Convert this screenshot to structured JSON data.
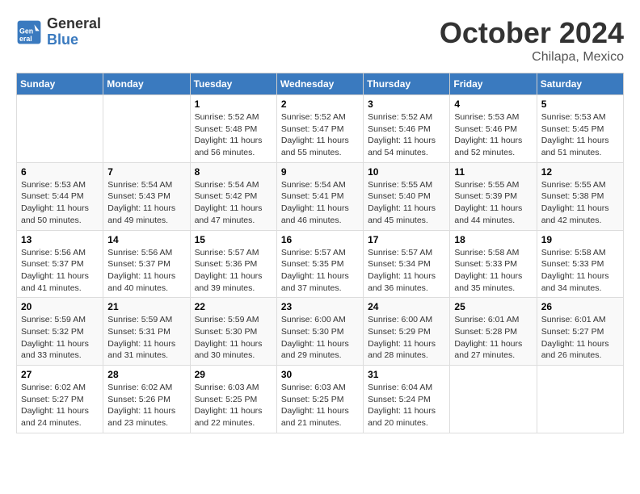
{
  "header": {
    "logo": {
      "line1": "General",
      "line2": "Blue"
    },
    "month": "October 2024",
    "location": "Chilapa, Mexico"
  },
  "weekdays": [
    "Sunday",
    "Monday",
    "Tuesday",
    "Wednesday",
    "Thursday",
    "Friday",
    "Saturday"
  ],
  "weeks": [
    [
      null,
      null,
      {
        "day": 1,
        "sunrise": "5:52 AM",
        "sunset": "5:48 PM",
        "daylight": "11 hours and 56 minutes."
      },
      {
        "day": 2,
        "sunrise": "5:52 AM",
        "sunset": "5:47 PM",
        "daylight": "11 hours and 55 minutes."
      },
      {
        "day": 3,
        "sunrise": "5:52 AM",
        "sunset": "5:46 PM",
        "daylight": "11 hours and 54 minutes."
      },
      {
        "day": 4,
        "sunrise": "5:53 AM",
        "sunset": "5:46 PM",
        "daylight": "11 hours and 52 minutes."
      },
      {
        "day": 5,
        "sunrise": "5:53 AM",
        "sunset": "5:45 PM",
        "daylight": "11 hours and 51 minutes."
      }
    ],
    [
      {
        "day": 6,
        "sunrise": "5:53 AM",
        "sunset": "5:44 PM",
        "daylight": "11 hours and 50 minutes."
      },
      {
        "day": 7,
        "sunrise": "5:54 AM",
        "sunset": "5:43 PM",
        "daylight": "11 hours and 49 minutes."
      },
      {
        "day": 8,
        "sunrise": "5:54 AM",
        "sunset": "5:42 PM",
        "daylight": "11 hours and 47 minutes."
      },
      {
        "day": 9,
        "sunrise": "5:54 AM",
        "sunset": "5:41 PM",
        "daylight": "11 hours and 46 minutes."
      },
      {
        "day": 10,
        "sunrise": "5:55 AM",
        "sunset": "5:40 PM",
        "daylight": "11 hours and 45 minutes."
      },
      {
        "day": 11,
        "sunrise": "5:55 AM",
        "sunset": "5:39 PM",
        "daylight": "11 hours and 44 minutes."
      },
      {
        "day": 12,
        "sunrise": "5:55 AM",
        "sunset": "5:38 PM",
        "daylight": "11 hours and 42 minutes."
      }
    ],
    [
      {
        "day": 13,
        "sunrise": "5:56 AM",
        "sunset": "5:37 PM",
        "daylight": "11 hours and 41 minutes."
      },
      {
        "day": 14,
        "sunrise": "5:56 AM",
        "sunset": "5:37 PM",
        "daylight": "11 hours and 40 minutes."
      },
      {
        "day": 15,
        "sunrise": "5:57 AM",
        "sunset": "5:36 PM",
        "daylight": "11 hours and 39 minutes."
      },
      {
        "day": 16,
        "sunrise": "5:57 AM",
        "sunset": "5:35 PM",
        "daylight": "11 hours and 37 minutes."
      },
      {
        "day": 17,
        "sunrise": "5:57 AM",
        "sunset": "5:34 PM",
        "daylight": "11 hours and 36 minutes."
      },
      {
        "day": 18,
        "sunrise": "5:58 AM",
        "sunset": "5:33 PM",
        "daylight": "11 hours and 35 minutes."
      },
      {
        "day": 19,
        "sunrise": "5:58 AM",
        "sunset": "5:33 PM",
        "daylight": "11 hours and 34 minutes."
      }
    ],
    [
      {
        "day": 20,
        "sunrise": "5:59 AM",
        "sunset": "5:32 PM",
        "daylight": "11 hours and 33 minutes."
      },
      {
        "day": 21,
        "sunrise": "5:59 AM",
        "sunset": "5:31 PM",
        "daylight": "11 hours and 31 minutes."
      },
      {
        "day": 22,
        "sunrise": "5:59 AM",
        "sunset": "5:30 PM",
        "daylight": "11 hours and 30 minutes."
      },
      {
        "day": 23,
        "sunrise": "6:00 AM",
        "sunset": "5:30 PM",
        "daylight": "11 hours and 29 minutes."
      },
      {
        "day": 24,
        "sunrise": "6:00 AM",
        "sunset": "5:29 PM",
        "daylight": "11 hours and 28 minutes."
      },
      {
        "day": 25,
        "sunrise": "6:01 AM",
        "sunset": "5:28 PM",
        "daylight": "11 hours and 27 minutes."
      },
      {
        "day": 26,
        "sunrise": "6:01 AM",
        "sunset": "5:27 PM",
        "daylight": "11 hours and 26 minutes."
      }
    ],
    [
      {
        "day": 27,
        "sunrise": "6:02 AM",
        "sunset": "5:27 PM",
        "daylight": "11 hours and 24 minutes."
      },
      {
        "day": 28,
        "sunrise": "6:02 AM",
        "sunset": "5:26 PM",
        "daylight": "11 hours and 23 minutes."
      },
      {
        "day": 29,
        "sunrise": "6:03 AM",
        "sunset": "5:25 PM",
        "daylight": "11 hours and 22 minutes."
      },
      {
        "day": 30,
        "sunrise": "6:03 AM",
        "sunset": "5:25 PM",
        "daylight": "11 hours and 21 minutes."
      },
      {
        "day": 31,
        "sunrise": "6:04 AM",
        "sunset": "5:24 PM",
        "daylight": "11 hours and 20 minutes."
      },
      null,
      null
    ]
  ]
}
